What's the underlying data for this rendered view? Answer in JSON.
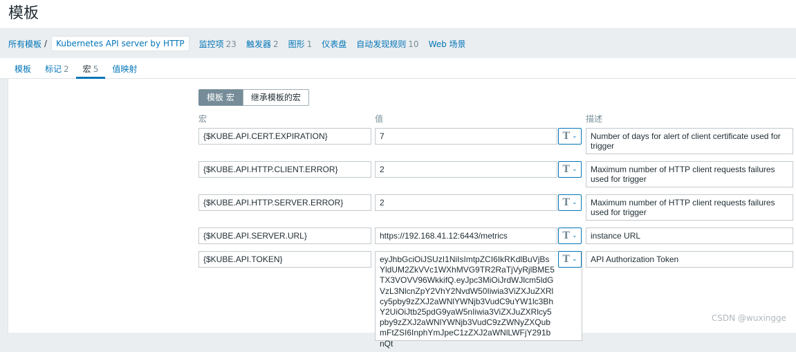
{
  "page": {
    "title": "模板"
  },
  "nav": {
    "all_templates": "所有模板",
    "separator": "/",
    "current_template": "Kubernetes API server by HTTP",
    "items": [
      {
        "label": "监控项",
        "count": "23"
      },
      {
        "label": "触发器",
        "count": "2"
      },
      {
        "label": "图形",
        "count": "1"
      },
      {
        "label": "仪表盘",
        "count": ""
      },
      {
        "label": "自动发现规则",
        "count": "10"
      },
      {
        "label": "Web 场景",
        "count": ""
      }
    ]
  },
  "tabs": [
    {
      "label": "模板",
      "count": ""
    },
    {
      "label": "标记",
      "count": "2"
    },
    {
      "label": "宏",
      "count": "5"
    },
    {
      "label": "值映射",
      "count": ""
    }
  ],
  "active_tab": "宏",
  "segment": {
    "template_macros": "模板 宏",
    "inherited_macros": "继承模板的宏"
  },
  "columns": {
    "macro": "宏",
    "value": "值",
    "description": "描述"
  },
  "macros": [
    {
      "macro": "{$KUBE.API.CERT.EXPIRATION}",
      "value": "7",
      "type_icon": "T",
      "description": "Number of days for alert of client certificate used for trigger"
    },
    {
      "macro": "{$KUBE.API.HTTP.CLIENT.ERROR}",
      "value": "2",
      "type_icon": "T",
      "description": "Maximum number of HTTP client requests failures used for trigger"
    },
    {
      "macro": "{$KUBE.API.HTTP.SERVER.ERROR}",
      "value": "2",
      "type_icon": "T",
      "description": "Maximum number of HTTP client requests failures used for trigger"
    },
    {
      "macro": "{$KUBE.API.SERVER.URL}",
      "value": "https://192.168.41.12:6443/metrics",
      "type_icon": "T",
      "description": "instance URL"
    },
    {
      "macro": "{$KUBE.API.TOKEN}",
      "value": "eyJhbGciOiJSUzI1NiIsImtpZCI6IkRKdlBuVjBsYldUM2ZkVVc1WXhMVG9TR2RaTjVyRjlBME5TX3VOVV96WkkifQ.eyJpc3MiOiJrdWJlcm5ldGVzL3NlcnZpY2VhY2NvdW50Iiwia3ViZXJuZXRlcy5pby9zZXJ2aWNlYWNjb3VudC9uYW1lc3BhY2UiOiJtb25pdG9yaW5nIiwia3ViZXJuZXRlcy5pby9zZXJ2aWNlYWNjb3VudC9zZWNyZXQubmFtZSI6InphYmJpeC1zZXJ2aWNlLWFjY291bnQt",
      "type_icon": "T",
      "description": "API Authorization Token"
    }
  ],
  "watermark": "CSDN @wuxingge"
}
